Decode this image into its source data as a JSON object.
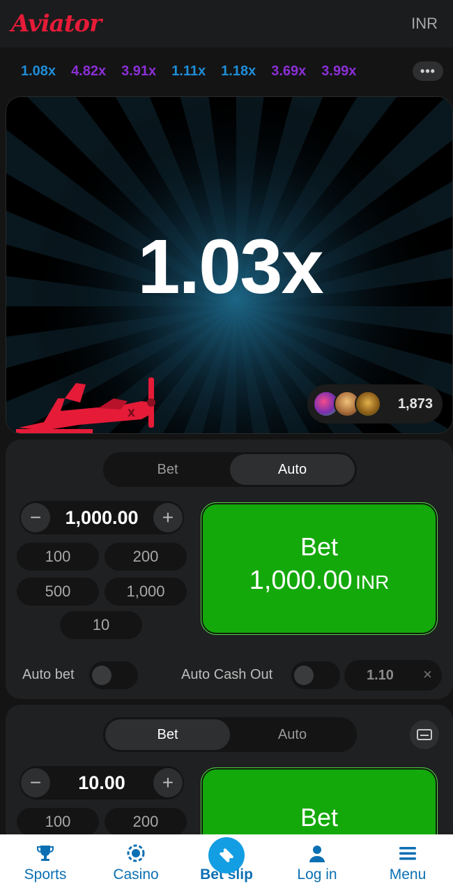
{
  "header": {
    "logo": "Aviator",
    "currency": "INR"
  },
  "history": [
    {
      "value": "1.08x",
      "color": "#1f8ed8"
    },
    {
      "value": "4.82x",
      "color": "#8b2fd6"
    },
    {
      "value": "3.91x",
      "color": "#8b2fd6"
    },
    {
      "value": "1.11x",
      "color": "#1f8ed8"
    },
    {
      "value": "1.18x",
      "color": "#1f8ed8"
    },
    {
      "value": "3.69x",
      "color": "#8b2fd6"
    },
    {
      "value": "3.99x",
      "color": "#8b2fd6"
    }
  ],
  "game": {
    "multiplier": "1.03x",
    "player_count": "1,873"
  },
  "panel1": {
    "tabs": [
      "Bet",
      "Auto"
    ],
    "active_tab": "Auto",
    "stake": "1,000.00",
    "chips": [
      "100",
      "200",
      "500",
      "1,000",
      "10"
    ],
    "bet_label": "Bet",
    "bet_amount": "1,000.00",
    "bet_currency": "INR",
    "auto_bet_label": "Auto bet",
    "auto_cashout_label": "Auto Cash Out",
    "auto_cashout_value": "1.10",
    "clear_symbol": "×"
  },
  "panel2": {
    "tabs": [
      "Bet",
      "Auto"
    ],
    "active_tab": "Bet",
    "stake": "10.00",
    "chips": [
      "100",
      "200"
    ],
    "bet_label": "Bet"
  },
  "stepper": {
    "minus": "−",
    "plus": "+"
  },
  "nav": [
    {
      "label": "Sports",
      "icon": "trophy-icon"
    },
    {
      "label": "Casino",
      "icon": "chip-icon"
    },
    {
      "label": "Bet slip",
      "icon": "ticket-icon"
    },
    {
      "label": "Log in",
      "icon": "user-icon"
    },
    {
      "label": "Menu",
      "icon": "hamburger-icon"
    }
  ],
  "colors": {
    "accent_red": "#e51b38",
    "bet_green": "#14a90b",
    "nav_blue": "#0b6fb3"
  }
}
